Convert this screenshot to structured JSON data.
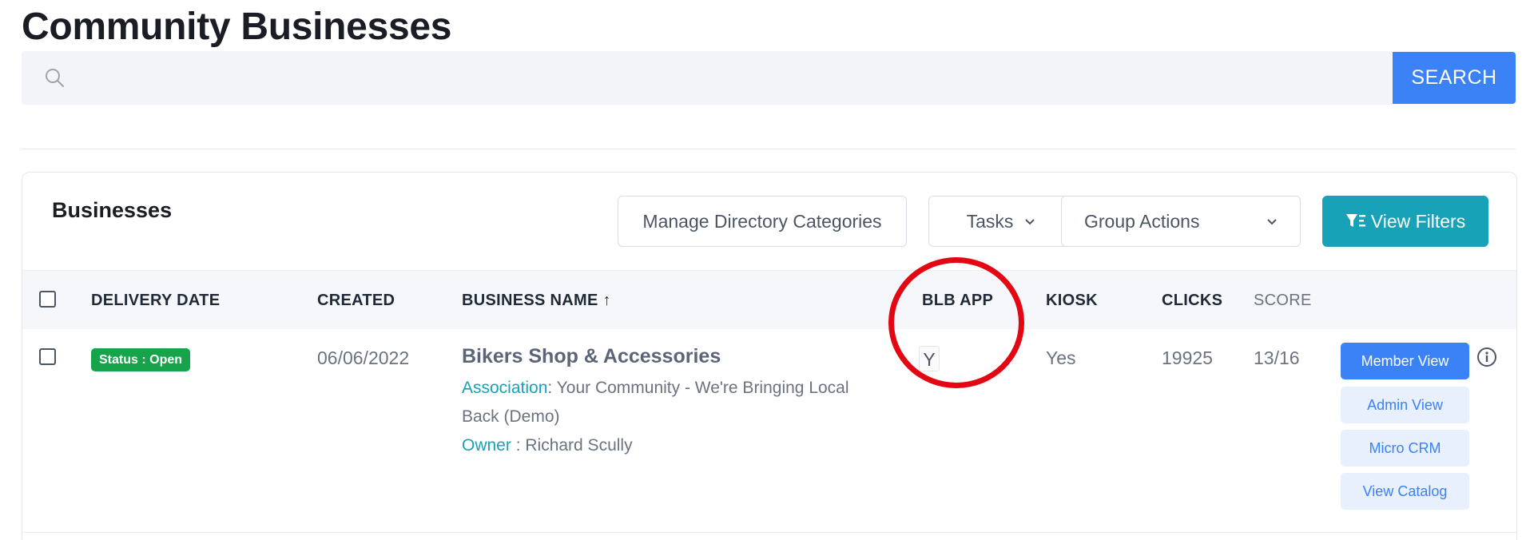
{
  "page": {
    "title": "Community Businesses"
  },
  "search": {
    "placeholder": "",
    "value": "",
    "button_label": "SEARCH"
  },
  "card": {
    "title": "Businesses",
    "toolbar": {
      "manage_categories": "Manage Directory Categories",
      "tasks": "Tasks",
      "group_actions": "Group Actions",
      "view_filters": "View Filters"
    }
  },
  "table": {
    "headers": {
      "delivery_date": "DELIVERY DATE",
      "created": "CREATED",
      "business_name": "BUSINESS NAME ↑",
      "blb_app": "BLB APP",
      "kiosk": "KIOSK",
      "clicks": "CLICKS",
      "score": "SCORE"
    },
    "rows": [
      {
        "status": "Status : Open",
        "created": "06/06/2022",
        "business_name": "Bikers Shop & Accessories",
        "association_label": "Association",
        "association_value": ": Your Community - We're Bringing Local Back (Demo)",
        "owner_label": "Owner",
        "owner_value": " : Richard Scully",
        "blb_app": "Y",
        "kiosk": "Yes",
        "clicks": "19925",
        "score": "13/16",
        "actions": {
          "member_view": "Member View",
          "admin_view": "Admin View",
          "micro_crm": "Micro CRM",
          "view_catalog": "View Catalog"
        }
      }
    ]
  },
  "colors": {
    "accent_blue": "#3b82f6",
    "teal": "#17a2b8",
    "status_green": "#16a34a",
    "highlight_red": "#e30613"
  },
  "icons": [
    "search-icon",
    "chevron-down-icon",
    "filter-icon",
    "info-icon"
  ]
}
